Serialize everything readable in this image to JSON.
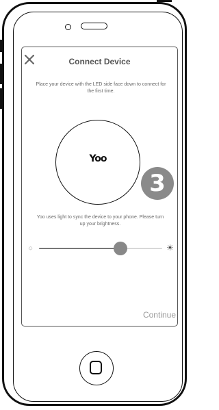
{
  "header": {
    "title": "Connect Device",
    "close_icon": "close-icon"
  },
  "main": {
    "instructions": "Place your device with the LED side face down to connect for the first time.",
    "device_logo": "Yoo",
    "step_number": "3",
    "sync_text": "Yoo uses light to sync the device to your phone. Please turn up your brightness."
  },
  "brightness": {
    "value": 0.66,
    "low_icon": "sun-dim-icon",
    "high_icon": "sun-bright-icon"
  },
  "footer": {
    "continue_label": "Continue"
  },
  "colors": {
    "badge": "#8a8a8a",
    "text_muted": "#666666",
    "continue": "#9a9a9a"
  }
}
